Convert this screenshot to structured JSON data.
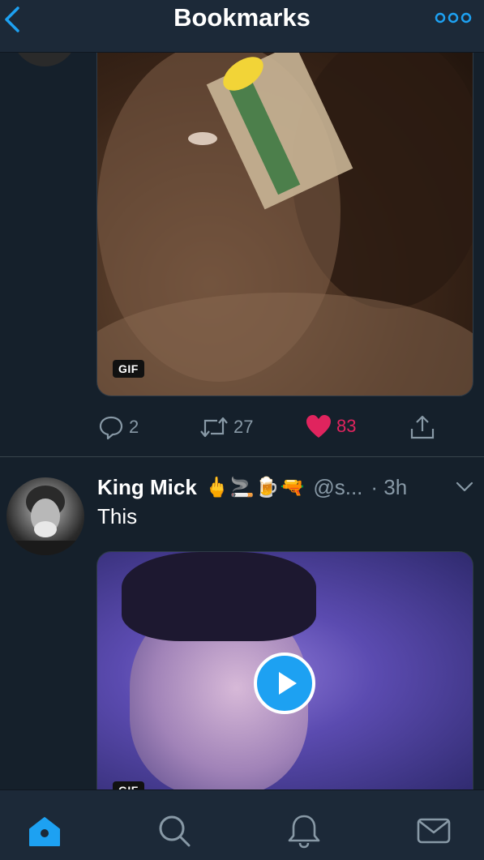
{
  "header": {
    "title": "Bookmarks"
  },
  "tweets": [
    {
      "media": {
        "badge": "GIF"
      },
      "actions": {
        "replies": "2",
        "retweets": "27",
        "likes": "83"
      }
    },
    {
      "name": "King Mick",
      "emojis": "🖕🚬🍺🔫",
      "handle": "@s...",
      "time": "· 3h",
      "text": "This",
      "media": {
        "badge": "GIF",
        "type": "video"
      }
    }
  ],
  "tabbar": {
    "items": [
      "home-icon",
      "search-icon",
      "notifications-icon",
      "messages-icon"
    ],
    "active": "home-icon"
  },
  "colors": {
    "accent": "#1da1f2",
    "like": "#e0245e",
    "background": "#15202b",
    "bar": "#1c2938",
    "muted": "#8899a6"
  }
}
